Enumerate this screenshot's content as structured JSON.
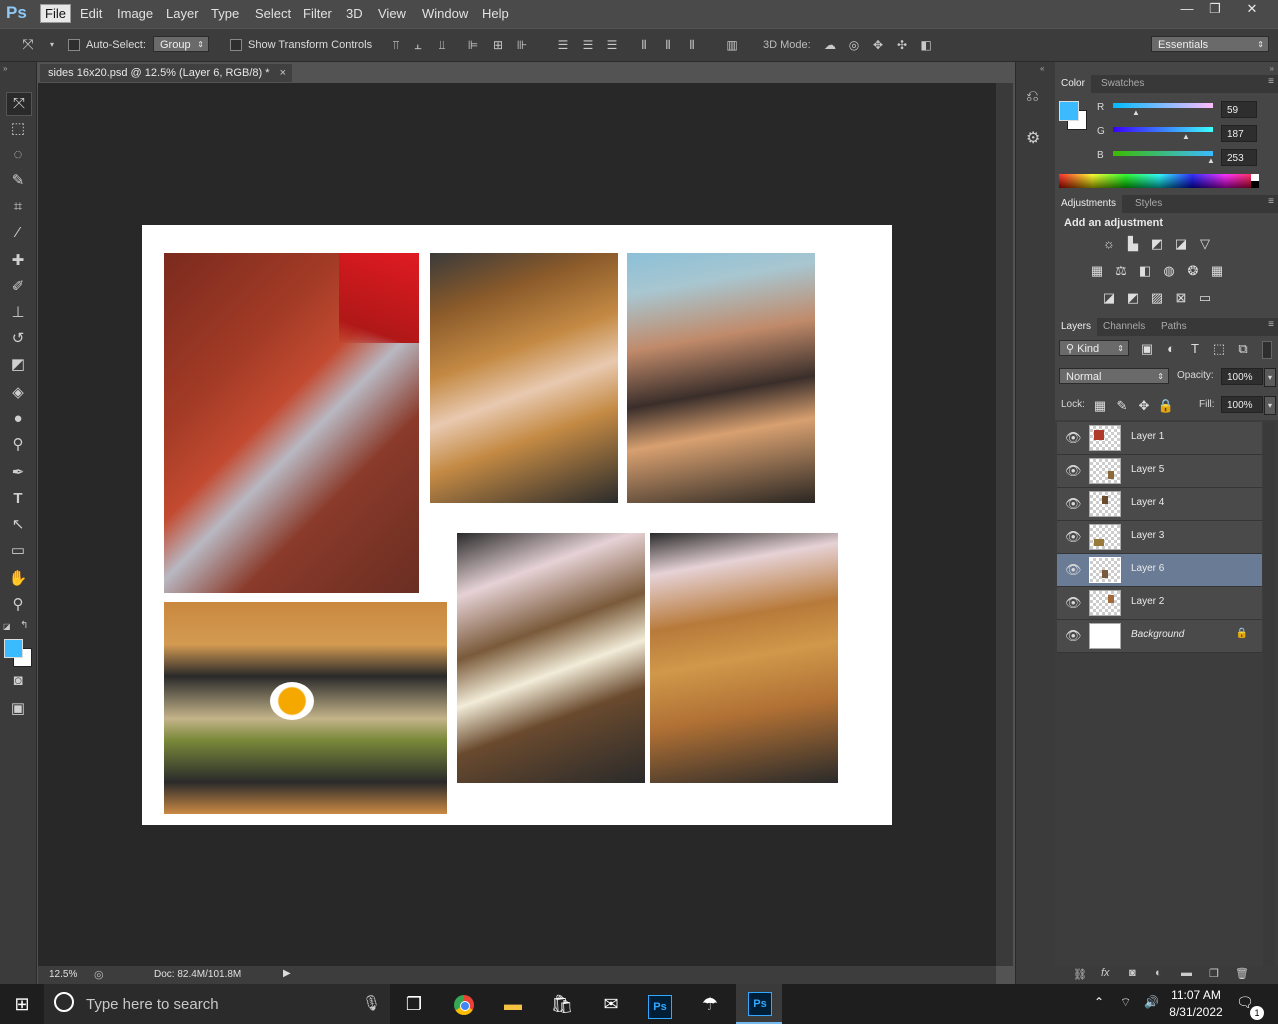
{
  "app": {
    "logo": "Ps",
    "menu": [
      "File",
      "Edit",
      "Image",
      "Layer",
      "Type",
      "Select",
      "Filter",
      "3D",
      "View",
      "Window",
      "Help"
    ],
    "window_controls": [
      "—",
      "❐",
      "✕"
    ]
  },
  "options_bar": {
    "auto_select_label": "Auto-Select:",
    "auto_select_value": "Group",
    "show_transform_label": "Show Transform Controls",
    "mode_3d_label": "3D Mode:",
    "workspace": "Essentials"
  },
  "document": {
    "tab_title": "sides 16x20.psd @ 12.5% (Layer 6, RGB/8) *",
    "close_glyph": "×"
  },
  "status": {
    "zoom": "12.5%",
    "doc_info": "Doc: 82.4M/101.8M"
  },
  "color_panel": {
    "tabs": [
      "Color",
      "Swatches"
    ],
    "foreground": "#3bbbfd",
    "r_label": "R",
    "g_label": "G",
    "b_label": "B",
    "r": "59",
    "g": "187",
    "b": "253"
  },
  "adjustments_panel": {
    "tabs": [
      "Adjustments",
      "Styles"
    ],
    "heading": "Add an adjustment"
  },
  "layers_panel": {
    "tabs": [
      "Layers",
      "Channels",
      "Paths"
    ],
    "filter_kind": "Kind",
    "blend_mode": "Normal",
    "opacity_label": "Opacity:",
    "opacity": "100%",
    "lock_label": "Lock:",
    "fill_label": "Fill:",
    "fill": "100%",
    "layers": [
      {
        "name": "Layer 1",
        "selected": false
      },
      {
        "name": "Layer 5",
        "selected": false
      },
      {
        "name": "Layer 4",
        "selected": false
      },
      {
        "name": "Layer 3",
        "selected": false
      },
      {
        "name": "Layer 6",
        "selected": true
      },
      {
        "name": "Layer 2",
        "selected": false
      },
      {
        "name": "Background",
        "selected": false
      }
    ]
  },
  "taskbar": {
    "search_placeholder": "Type here to search",
    "time": "11:07 AM",
    "date": "8/31/2022",
    "ps_label": "Ps",
    "notification_count": "1"
  }
}
